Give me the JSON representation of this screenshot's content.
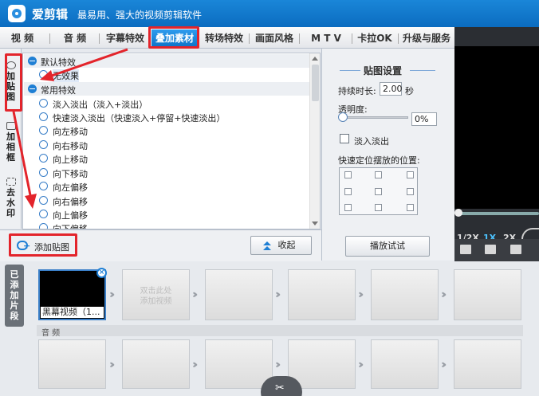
{
  "app": {
    "name": "爱剪辑",
    "slogan": "最易用、强大的视频剪辑软件"
  },
  "tabs": [
    {
      "label": "视  频"
    },
    {
      "label": "音  频"
    },
    {
      "label": "字幕特效"
    },
    {
      "label": "叠加素材",
      "active": true
    },
    {
      "label": "转场特效"
    },
    {
      "label": "画面风格"
    },
    {
      "label": "M T V"
    },
    {
      "label": "卡拉OK"
    },
    {
      "label": "升级与服务"
    }
  ],
  "side_tabs": [
    {
      "label": "加贴图",
      "active": true
    },
    {
      "label": "加相框"
    },
    {
      "label": "去水印"
    }
  ],
  "effects": {
    "default_category": "默认特效",
    "default_item": "无效果",
    "common_category": "常用特效",
    "items": [
      "淡入淡出（淡入+淡出）",
      "快速淡入淡出（快速淡入+停留+快速淡出）",
      "向左移动",
      "向右移动",
      "向上移动",
      "向下移动",
      "向左偏移",
      "向右偏移",
      "向上偏移",
      "向下偏移"
    ]
  },
  "settings": {
    "title": "贴图设置",
    "duration_label": "持续时长:",
    "duration_value": "2.00",
    "duration_unit": "秒",
    "opacity_label": "透明度:",
    "opacity_value": "0%",
    "opacity": 0,
    "fade_label": "淡入淡出",
    "position_label": "快速定位摆放的位置:",
    "preview_button": "播放试试"
  },
  "strip": {
    "add_label": "添加贴图",
    "collapse_label": "收起"
  },
  "preview": {
    "speeds": [
      "1/2X",
      "1X",
      "2X"
    ],
    "active_speed": "1X"
  },
  "timeline": {
    "side_label": "已添加片段",
    "first_clip_caption": "黑幕视频（1...",
    "add_clip_hint": "双击此处\n添加视频",
    "audio_label": "音  频"
  },
  "colors": {
    "accent": "#1f7fd4",
    "annotation": "#e3242b",
    "title_bar": "#0b6cc0"
  }
}
